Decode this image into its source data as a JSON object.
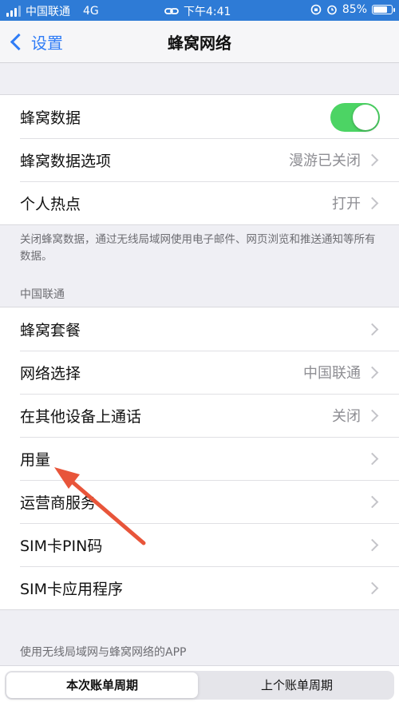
{
  "status_bar": {
    "carrier": "中国联通",
    "network": "4G",
    "time": "下午4:41",
    "battery": "85%",
    "battery_level": 0.85
  },
  "nav": {
    "back_label": "设置",
    "title": "蜂窝网络"
  },
  "group1": {
    "rows": [
      {
        "label": "蜂窝数据",
        "toggle_on": true
      },
      {
        "label": "蜂窝数据选项",
        "value": "漫游已关闭"
      },
      {
        "label": "个人热点",
        "value": "打开"
      }
    ],
    "footnote": "关闭蜂窝数据，通过无线局域网使用电子邮件、网页浏览和推送通知等所有数据。"
  },
  "carrier_section": {
    "header": "中国联通",
    "rows": [
      {
        "label": "蜂窝套餐",
        "value": ""
      },
      {
        "label": "网络选择",
        "value": "中国联通"
      },
      {
        "label": "在其他设备上通话",
        "value": "关闭"
      },
      {
        "label": "用量",
        "value": ""
      },
      {
        "label": "运营商服务",
        "value": ""
      },
      {
        "label": "SIM卡PIN码",
        "value": ""
      },
      {
        "label": "SIM卡应用程序",
        "value": ""
      }
    ]
  },
  "apps_section": {
    "header": "使用无线局域网与蜂窝网络的APP"
  },
  "segmented": {
    "current": "本次账单周期",
    "previous": "上个账单周期"
  },
  "colors": {
    "accent": "#2f7cf6",
    "toggle_on": "#4cd464",
    "annotation_arrow": "#e8553a"
  }
}
